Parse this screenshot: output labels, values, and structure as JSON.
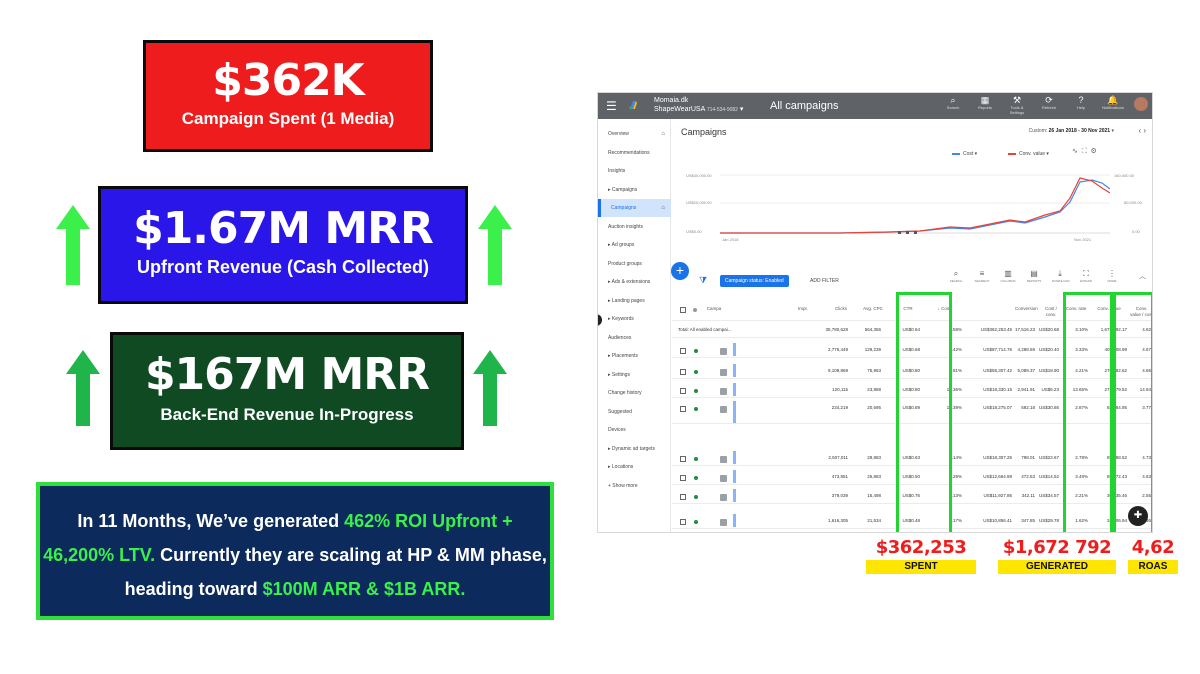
{
  "cards": {
    "campaign": {
      "big": "$362K",
      "sub": "Campaign Spent (1 Media)",
      "color": "#ee1c1c"
    },
    "upfront": {
      "big": "$1.67M MRR",
      "sub": "Upfront Revenue (Cash Collected)",
      "color": "#2a16e8"
    },
    "backend": {
      "big": "$167M MRR",
      "sub": "Back-End Revenue In-Progress",
      "color": "#0f4a22"
    }
  },
  "summary": {
    "t1": "In 11 Months, We’ve generated ",
    "h1": "462% ROI Upfront + 46,200% LTV.",
    "t2": " Currently they are scaling at HP & MM phase, heading toward ",
    "h2": "$100M ARR & $1B ARR."
  },
  "ads": {
    "topbar": {
      "account_line1": "Momaia.dk",
      "account_line2": "ShapeWearUSA",
      "account_id": "714-534-9082",
      "title": "All campaigns",
      "tools": [
        {
          "icon": "⌕",
          "label": "Search"
        },
        {
          "icon": "▦",
          "label": "Reports"
        },
        {
          "icon": "⚒",
          "label": "Tools & Settings"
        },
        {
          "icon": "⟳",
          "label": "Refresh"
        },
        {
          "icon": "?",
          "label": "Help"
        },
        {
          "icon": "🔔",
          "label": "Notifications"
        }
      ]
    },
    "sidebar": [
      {
        "label": "Overview",
        "home": true
      },
      {
        "label": "Recommendations"
      },
      {
        "label": "Insights"
      },
      {
        "label": "▸ Campaigns"
      },
      {
        "label": "Campaigns",
        "active": true,
        "home": true
      },
      {
        "label": "Auction insights"
      },
      {
        "label": "▸ Ad groups"
      },
      {
        "label": "Product groups"
      },
      {
        "label": "▸ Ads & extensions"
      },
      {
        "label": "▸ Landing pages"
      },
      {
        "label": "▸ Keywords"
      },
      {
        "label": "Audiences"
      },
      {
        "label": "▸ Placements"
      },
      {
        "label": "▸ Settings"
      },
      {
        "label": "Change history"
      },
      {
        "label": "Suggested"
      },
      {
        "label": "Devices"
      },
      {
        "label": "▸ Dynamic ad targets"
      },
      {
        "label": "▸ Locations"
      },
      {
        "label": "+ Show more"
      }
    ],
    "main": {
      "title": "Campaigns",
      "date_prefix": "Custom",
      "date_range": "26 Jan 2018 - 30 Nov 2021",
      "legend_cost": "Cost",
      "legend_conv": "Conv. value",
      "chart_tools": [
        "SHOW TYPE",
        "EXPAND",
        "ADJUST"
      ],
      "y_left": [
        "US$40,000.00",
        "US$20,000.00",
        "US$0.00"
      ],
      "y_right": [
        "160,000.00",
        "80,000.00",
        "0.00"
      ],
      "x_start": "Jan 2018",
      "x_end": "Nov 2021"
    },
    "toolbar": {
      "chip": "Campaign status: Enabled",
      "add_filter": "ADD FILTER",
      "tools": [
        {
          "icon": "⌕",
          "label": "SEARCH"
        },
        {
          "icon": "≡",
          "label": "SEGMENT"
        },
        {
          "icon": "▥",
          "label": "COLUMNS"
        },
        {
          "icon": "▤",
          "label": "REPORTS"
        },
        {
          "icon": "⤓",
          "label": "DOWNLOAD"
        },
        {
          "icon": "⛶",
          "label": "EXPAND"
        },
        {
          "icon": "⋮",
          "label": "MORE"
        }
      ],
      "collapse": "︿"
    },
    "table": {
      "headers": [
        "Campa",
        "Impr.",
        "Clicks",
        "Avg. CPC",
        "CTR",
        "↓ Cost",
        "Conversion",
        "Cost / conv.",
        "Conv. rate",
        "Conv. value",
        "Conv. value / cost"
      ],
      "total_label": "Total: All enabled campai...",
      "total": [
        "35,780,628",
        "564,356",
        "US$0.64",
        "1.58%",
        "US$362,253.45",
        "17,516.23",
        "US$20.68",
        "3.10%",
        "1,672,792.17",
        "4.62"
      ],
      "rows": [
        [
          "2,776,449",
          "129,239",
          "US$0.68",
          "3.42%",
          "US$87,714.76",
          "4,298.69",
          "US$20.40",
          "3.33%",
          "409,808.99",
          "4.67"
        ],
        [
          "9,109,869",
          "75,963",
          "US$0.80",
          "0.81%",
          "US$58,307.42",
          "5,089.37",
          "US$18.90",
          "4.21%",
          "270,582.62",
          "4.65"
        ],
        [
          "120,115",
          "23,888",
          "US$0.80",
          "19.36%",
          "US$18,330.15",
          "2,941.91",
          "US$6.23",
          "13.65%",
          "273,879.52",
          "14.94"
        ],
        [
          "234,219",
          "20,695",
          "US$0.89",
          "10.39%",
          "US$18,275.07",
          "592.18",
          "US$30.86",
          "2.87%",
          "68,984.95",
          "3.77"
        ],
        [
          "2,507,011",
          "28,883",
          "US$0.63",
          "1.14%",
          "US$18,307.25",
          "798.01",
          "US$22.67",
          "2.78%",
          "85,588.52",
          "4.73"
        ],
        [
          "473,851",
          "25,883",
          "US$0.50",
          "5.29%",
          "US$12,664.88",
          "472.53",
          "US$14.52",
          "3.48%",
          "86,472.43",
          "4.63"
        ],
        [
          "379,039",
          "15,498",
          "US$0.76",
          "4.13%",
          "US$11,927.86",
          "342.11",
          "US$34.57",
          "2.21%",
          "30,135.46",
          "2.55"
        ],
        [
          "1,616,305",
          "21,534",
          "US$0.48",
          "1.17%",
          "US$10,856.41",
          "347.85",
          "US$29.78",
          "1.62%",
          "34,806.94",
          "3.36"
        ],
        [
          "130,071",
          "9,635",
          "US$0.97",
          "7.29%",
          "US$8,899.50",
          "293.36",
          "US$31.41",
          "2.92%",
          "30,888.10",
          "3.49"
        ]
      ]
    }
  },
  "stats": [
    {
      "value": "$362,253",
      "label": "SPENT"
    },
    {
      "value": "$1,672 792",
      "label": "GENERATED"
    },
    {
      "value": "4,62",
      "label": "ROAS"
    }
  ],
  "colors": {
    "accent_green": "#2fe03d",
    "highlight": "#3af04a",
    "stat_red": "#ef1c1c",
    "stat_yellow": "#ffe600"
  }
}
